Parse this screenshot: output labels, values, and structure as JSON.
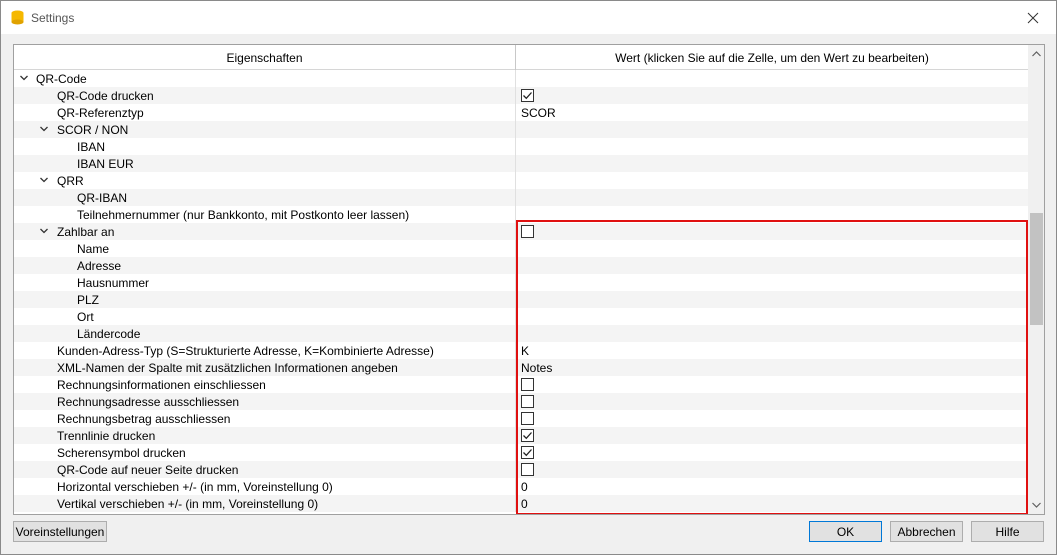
{
  "window": {
    "title": "Settings"
  },
  "grid": {
    "col_property": "Eigenschaften",
    "col_value": "Wert (klicken Sie auf die Zelle, um den Wert zu bearbeiten)",
    "rows": [
      {
        "label": "QR-Code",
        "level": 0,
        "expandable": true,
        "value": "",
        "type": "text"
      },
      {
        "label": "QR-Code drucken",
        "level": 1,
        "value": "",
        "type": "checkbox",
        "checked": true
      },
      {
        "label": "QR-Referenztyp",
        "level": 1,
        "value": "SCOR",
        "type": "text"
      },
      {
        "label": "SCOR / NON",
        "level": 1,
        "expandable": true,
        "value": "",
        "type": "text"
      },
      {
        "label": "IBAN",
        "level": 2,
        "value": "",
        "type": "text"
      },
      {
        "label": "IBAN EUR",
        "level": 2,
        "value": "",
        "type": "text"
      },
      {
        "label": "QRR",
        "level": 1,
        "expandable": true,
        "value": "",
        "type": "text"
      },
      {
        "label": "QR-IBAN",
        "level": 2,
        "value": "",
        "type": "text"
      },
      {
        "label": "Teilnehmernummer (nur Bankkonto, mit Postkonto leer lassen)",
        "level": 2,
        "value": "",
        "type": "text"
      },
      {
        "label": "Zahlbar an",
        "level": 1,
        "expandable": true,
        "value": "",
        "type": "checkbox",
        "checked": false
      },
      {
        "label": "Name",
        "level": 2,
        "value": "",
        "type": "text"
      },
      {
        "label": "Adresse",
        "level": 2,
        "value": "",
        "type": "text"
      },
      {
        "label": "Hausnummer",
        "level": 2,
        "value": "",
        "type": "text"
      },
      {
        "label": "PLZ",
        "level": 2,
        "value": "",
        "type": "text"
      },
      {
        "label": "Ort",
        "level": 2,
        "value": "",
        "type": "text"
      },
      {
        "label": "Ländercode",
        "level": 2,
        "value": "",
        "type": "text"
      },
      {
        "label": "Kunden-Adress-Typ (S=Strukturierte Adresse, K=Kombinierte Adresse)",
        "level": 1,
        "value": "K",
        "type": "text"
      },
      {
        "label": "XML-Namen der Spalte mit zusätzlichen Informationen angeben",
        "level": 1,
        "value": "Notes",
        "type": "text"
      },
      {
        "label": "Rechnungsinformationen einschliessen",
        "level": 1,
        "value": "",
        "type": "checkbox",
        "checked": false
      },
      {
        "label": "Rechnungsadresse ausschliessen",
        "level": 1,
        "value": "",
        "type": "checkbox",
        "checked": false
      },
      {
        "label": "Rechnungsbetrag ausschliessen",
        "level": 1,
        "value": "",
        "type": "checkbox",
        "checked": false
      },
      {
        "label": "Trennlinie drucken",
        "level": 1,
        "value": "",
        "type": "checkbox",
        "checked": true
      },
      {
        "label": "Scherensymbol drucken",
        "level": 1,
        "value": "",
        "type": "checkbox",
        "checked": true
      },
      {
        "label": "QR-Code auf neuer Seite drucken",
        "level": 1,
        "value": "",
        "type": "checkbox",
        "checked": false
      },
      {
        "label": "Horizontal verschieben +/- (in mm, Voreinstellung 0)",
        "level": 1,
        "value": "0",
        "type": "text"
      },
      {
        "label": "Vertikal verschieben +/- (in mm, Voreinstellung 0)",
        "level": 1,
        "value": "0",
        "type": "text"
      }
    ]
  },
  "buttons": {
    "defaults": "Voreinstellungen",
    "ok": "OK",
    "cancel": "Abbrechen",
    "help": "Hilfe"
  },
  "colors": {
    "highlight": "#e01010",
    "accent": "#0078d7",
    "app_icon": "#f5b800"
  }
}
